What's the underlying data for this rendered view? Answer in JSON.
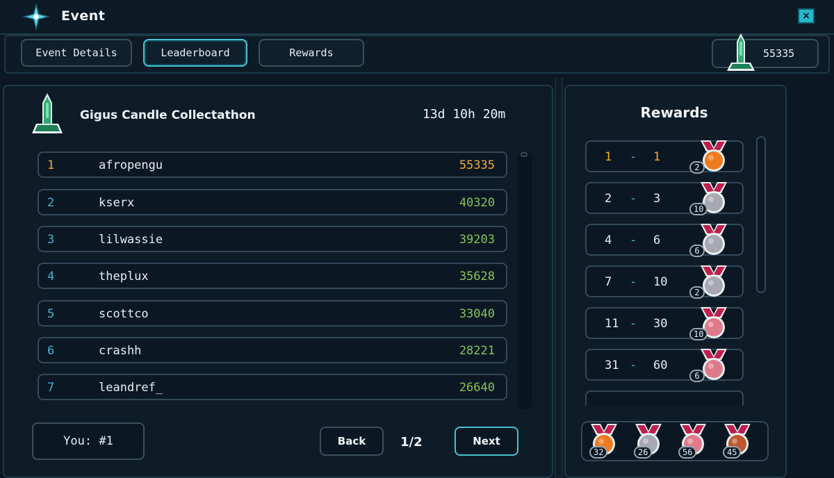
{
  "window": {
    "title": "Event",
    "close_icon": "close-icon"
  },
  "tabs": [
    {
      "label": "Event Details",
      "active": false
    },
    {
      "label": "Leaderboard",
      "active": true
    },
    {
      "label": "Rewards",
      "active": false
    }
  ],
  "currency": {
    "icon": "candle-icon",
    "value": "55335"
  },
  "event": {
    "name": "Gigus Candle Collectathon",
    "time_left": "13d 10h 20m",
    "icon": "candle-icon"
  },
  "leaderboard": [
    {
      "rank": "1",
      "name": "afropengu",
      "score": "55335"
    },
    {
      "rank": "2",
      "name": "kserx",
      "score": "40320"
    },
    {
      "rank": "3",
      "name": "lilwassie",
      "score": "39203"
    },
    {
      "rank": "4",
      "name": "theplux",
      "score": "35628"
    },
    {
      "rank": "5",
      "name": "scottco",
      "score": "33040"
    },
    {
      "rank": "6",
      "name": "crashh",
      "score": "28221"
    },
    {
      "rank": "7",
      "name": "leandref_",
      "score": "26640"
    }
  ],
  "you": {
    "label": "You: #1"
  },
  "pager": {
    "back": "Back",
    "next": "Next",
    "page": "1/2"
  },
  "rewards": {
    "title": "Rewards",
    "tiers": [
      {
        "from": "1",
        "to": "1",
        "medal": "orange-medal-icon",
        "count": "2"
      },
      {
        "from": "2",
        "to": "3",
        "medal": "silver-medal-icon",
        "count": "10"
      },
      {
        "from": "4",
        "to": "6",
        "medal": "silver-medal-icon",
        "count": "6"
      },
      {
        "from": "7",
        "to": "10",
        "medal": "silver-medal-icon",
        "count": "2"
      },
      {
        "from": "11",
        "to": "30",
        "medal": "pink-medal-icon",
        "count": "10"
      },
      {
        "from": "31",
        "to": "60",
        "medal": "pink-medal-icon",
        "count": "6"
      }
    ],
    "tray": [
      {
        "medal": "orange-medal-icon",
        "count": "32"
      },
      {
        "medal": "silver-medal-icon",
        "count": "26"
      },
      {
        "medal": "pink-medal-icon",
        "count": "56"
      },
      {
        "medal": "bronze-medal-icon",
        "count": "45"
      }
    ]
  },
  "colors": {
    "accent": "#49c2d2",
    "gold": "#f2a93b",
    "score_green": "#86c35b",
    "rank_teal": "#45b3c8",
    "medal_orange": "#f07a1e",
    "medal_silver": "#a8a8b4",
    "medal_pink": "#e07a8a",
    "medal_bronze": "#c0562e",
    "ribbon": "#c01e4e"
  }
}
